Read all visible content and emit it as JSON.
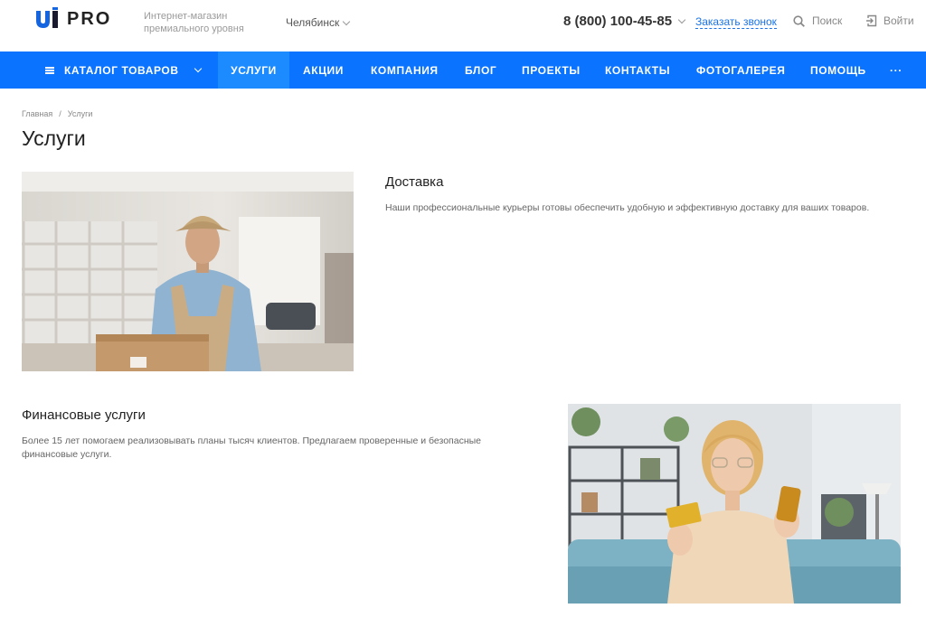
{
  "header": {
    "logo_text": "PRO",
    "tagline": "Интернет-магазин премиального уровня",
    "city": "Челябинск",
    "phone": "8 (800) 100-45-85",
    "callback_label": "Заказать звонок",
    "search_label": "Поиск",
    "login_label": "Войти"
  },
  "nav": {
    "catalog_label": "КАТАЛОГ ТОВАРОВ",
    "items": [
      "УСЛУГИ",
      "АКЦИИ",
      "КОМПАНИЯ",
      "БЛОГ",
      "ПРОЕКТЫ",
      "КОНТАКТЫ",
      "ФОТОГАЛЕРЕЯ",
      "ПОМОЩЬ"
    ],
    "more_label": "···",
    "active_item": "УСЛУГИ"
  },
  "breadcrumb": [
    "Главная",
    "/",
    "Услуги"
  ],
  "page_title": "Услуги",
  "services": [
    {
      "title": "Доставка",
      "description": "Наши профессиональные курьеры готовы обеспечить удобную и эффективную доставку для ваших товаров."
    },
    {
      "title": "Финансовые услуги",
      "description": "Более 15 лет помогаем реализовывать планы тысяч клиентов. Предлагаем проверенные и безопасные финансовые услуги."
    }
  ],
  "colors": {
    "accent": "#0a73ff",
    "accent_active": "#1c8bff",
    "link": "#1a73e8"
  }
}
